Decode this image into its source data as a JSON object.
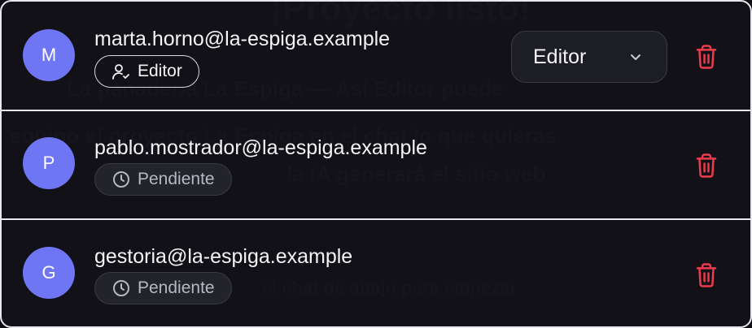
{
  "members": [
    {
      "initial": "M",
      "email": "marta.horno@la-espiga.example",
      "badge_label": "Editor",
      "badge_icon": "user-check-icon",
      "role_select_value": "Editor",
      "has_role_select": true
    },
    {
      "initial": "P",
      "email": "pablo.mostrador@la-espiga.example",
      "badge_label": "Pendiente",
      "badge_icon": "clock-icon",
      "has_role_select": false
    },
    {
      "initial": "G",
      "email": "gestoria@la-espiga.example",
      "badge_label": "Pendiente",
      "badge_icon": "clock-icon",
      "has_role_select": false
    }
  ],
  "colors": {
    "avatar": "#6f76f4",
    "delete": "#ef3b4b",
    "panel_bg": "#111117",
    "border": "#e8e8ee"
  },
  "icons": {
    "delete": "trash-icon",
    "dropdown": "chevron-down-icon"
  }
}
